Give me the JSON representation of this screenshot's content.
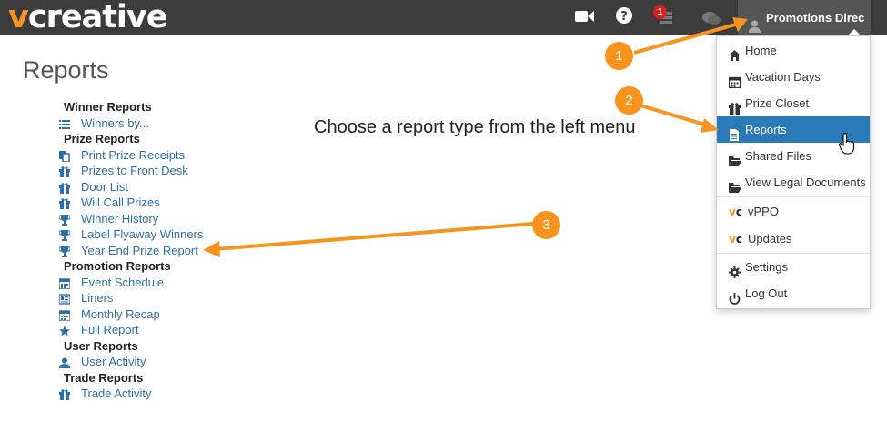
{
  "app": {
    "logo_v": "v",
    "logo_rest": "creative"
  },
  "topbar": {
    "icons": [
      "video-camera-icon",
      "help-icon",
      "notifications-icon",
      "chat-icon"
    ],
    "notification_count": "1",
    "user_label": "Promotions Direc"
  },
  "page": {
    "title": "Reports",
    "instruction": "Choose a report type from the left menu"
  },
  "sections": [
    {
      "heading": "Winner Reports",
      "items": [
        {
          "label": "Winners by...",
          "icon": "list-icon"
        }
      ]
    },
    {
      "heading": "Prize Reports",
      "items": [
        {
          "label": "Print Prize Receipts",
          "icon": "copy-icon"
        },
        {
          "label": "Prizes to Front Desk",
          "icon": "gift-icon"
        },
        {
          "label": "Door List",
          "icon": "gift-icon"
        },
        {
          "label": "Will Call Prizes",
          "icon": "gift-icon"
        },
        {
          "label": "Winner History",
          "icon": "trophy-icon"
        },
        {
          "label": "Label Flyaway Winners",
          "icon": "trophy-icon"
        },
        {
          "label": "Year End Prize Report",
          "icon": "trophy-icon"
        }
      ]
    },
    {
      "heading": "Promotion Reports",
      "items": [
        {
          "label": "Event Schedule",
          "icon": "calendar-icon"
        },
        {
          "label": "Liners",
          "icon": "id-card-icon"
        },
        {
          "label": "Monthly Recap",
          "icon": "calendar-icon"
        },
        {
          "label": "Full Report",
          "icon": "star-icon"
        }
      ]
    },
    {
      "heading": "User Reports",
      "items": [
        {
          "label": "User Activity",
          "icon": "user-icon"
        }
      ]
    },
    {
      "heading": "Trade Reports",
      "items": [
        {
          "label": "Trade Activity",
          "icon": "gift-icon"
        }
      ]
    }
  ],
  "dropdown": {
    "items": [
      {
        "label": "Home",
        "icon": "home-icon"
      },
      {
        "label": "Vacation Days",
        "icon": "calendar-icon"
      },
      {
        "label": "Prize Closet",
        "icon": "gift-icon"
      },
      {
        "label": "Reports",
        "icon": "file-text-icon",
        "active": true
      },
      {
        "label": "Shared Files",
        "icon": "folder-open-icon"
      },
      {
        "label": "View Legal Documents",
        "icon": "folder-open-icon"
      },
      {
        "label": "vPPO",
        "icon": "vc-logo-icon"
      },
      {
        "label": "Updates",
        "icon": "vc-logo-icon"
      },
      {
        "label": "Settings",
        "icon": "gear-icon"
      },
      {
        "label": "Log Out",
        "icon": "power-icon"
      }
    ]
  },
  "annotations": [
    {
      "number": "1",
      "color": "#f7941d"
    },
    {
      "number": "2",
      "color": "#f7941d"
    },
    {
      "number": "3",
      "color": "#f7941d"
    }
  ],
  "colors": {
    "topbar": "#3c3c3c",
    "accent": "#f7941d",
    "link": "#2f6fa8",
    "active": "#2a7ab8"
  }
}
